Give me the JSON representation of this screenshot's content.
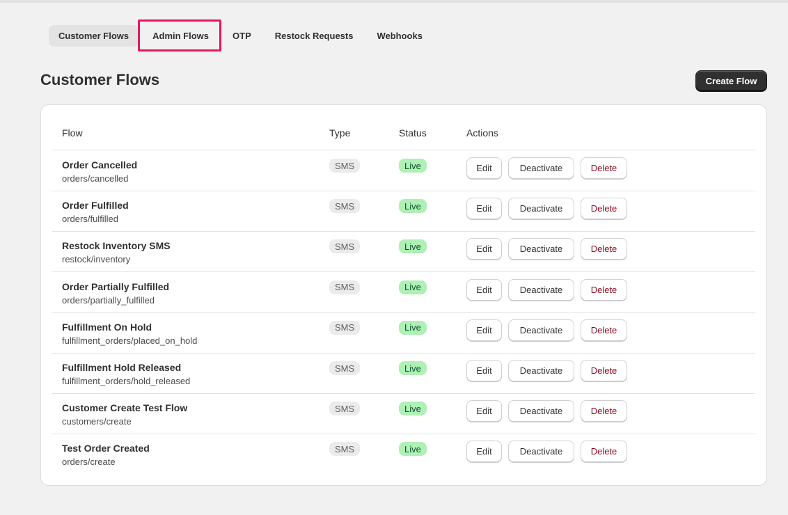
{
  "tabs": [
    {
      "label": "Customer Flows",
      "active": true
    },
    {
      "label": "Admin Flows",
      "active": false
    },
    {
      "label": "OTP",
      "active": false
    },
    {
      "label": "Restock Requests",
      "active": false
    },
    {
      "label": "Webhooks",
      "active": false
    }
  ],
  "header": {
    "title": "Customer Flows",
    "create_label": "Create Flow"
  },
  "table": {
    "columns": {
      "flow": "Flow",
      "type": "Type",
      "status": "Status",
      "actions": "Actions"
    },
    "action_labels": {
      "edit": "Edit",
      "deactivate": "Deactivate",
      "delete": "Delete"
    },
    "rows": [
      {
        "name": "Order Cancelled",
        "path": "orders/cancelled",
        "type": "SMS",
        "status": "Live"
      },
      {
        "name": "Order Fulfilled",
        "path": "orders/fulfilled",
        "type": "SMS",
        "status": "Live"
      },
      {
        "name": "Restock Inventory SMS",
        "path": "restock/inventory",
        "type": "SMS",
        "status": "Live"
      },
      {
        "name": "Order Partially Fulfilled",
        "path": "orders/partially_fulfilled",
        "type": "SMS",
        "status": "Live"
      },
      {
        "name": "Fulfillment On Hold",
        "path": "fulfillment_orders/placed_on_hold",
        "type": "SMS",
        "status": "Live"
      },
      {
        "name": "Fulfillment Hold Released",
        "path": "fulfillment_orders/hold_released",
        "type": "SMS",
        "status": "Live"
      },
      {
        "name": "Customer Create Test Flow",
        "path": "customers/create",
        "type": "SMS",
        "status": "Live"
      },
      {
        "name": "Test Order Created",
        "path": "orders/create",
        "type": "SMS",
        "status": "Live"
      }
    ]
  },
  "colors": {
    "background": "#f1f1f1",
    "highlight": "#e5175f",
    "live_badge": "#aff0b5",
    "delete_text": "#8e0b21",
    "primary_button": "#303030"
  }
}
